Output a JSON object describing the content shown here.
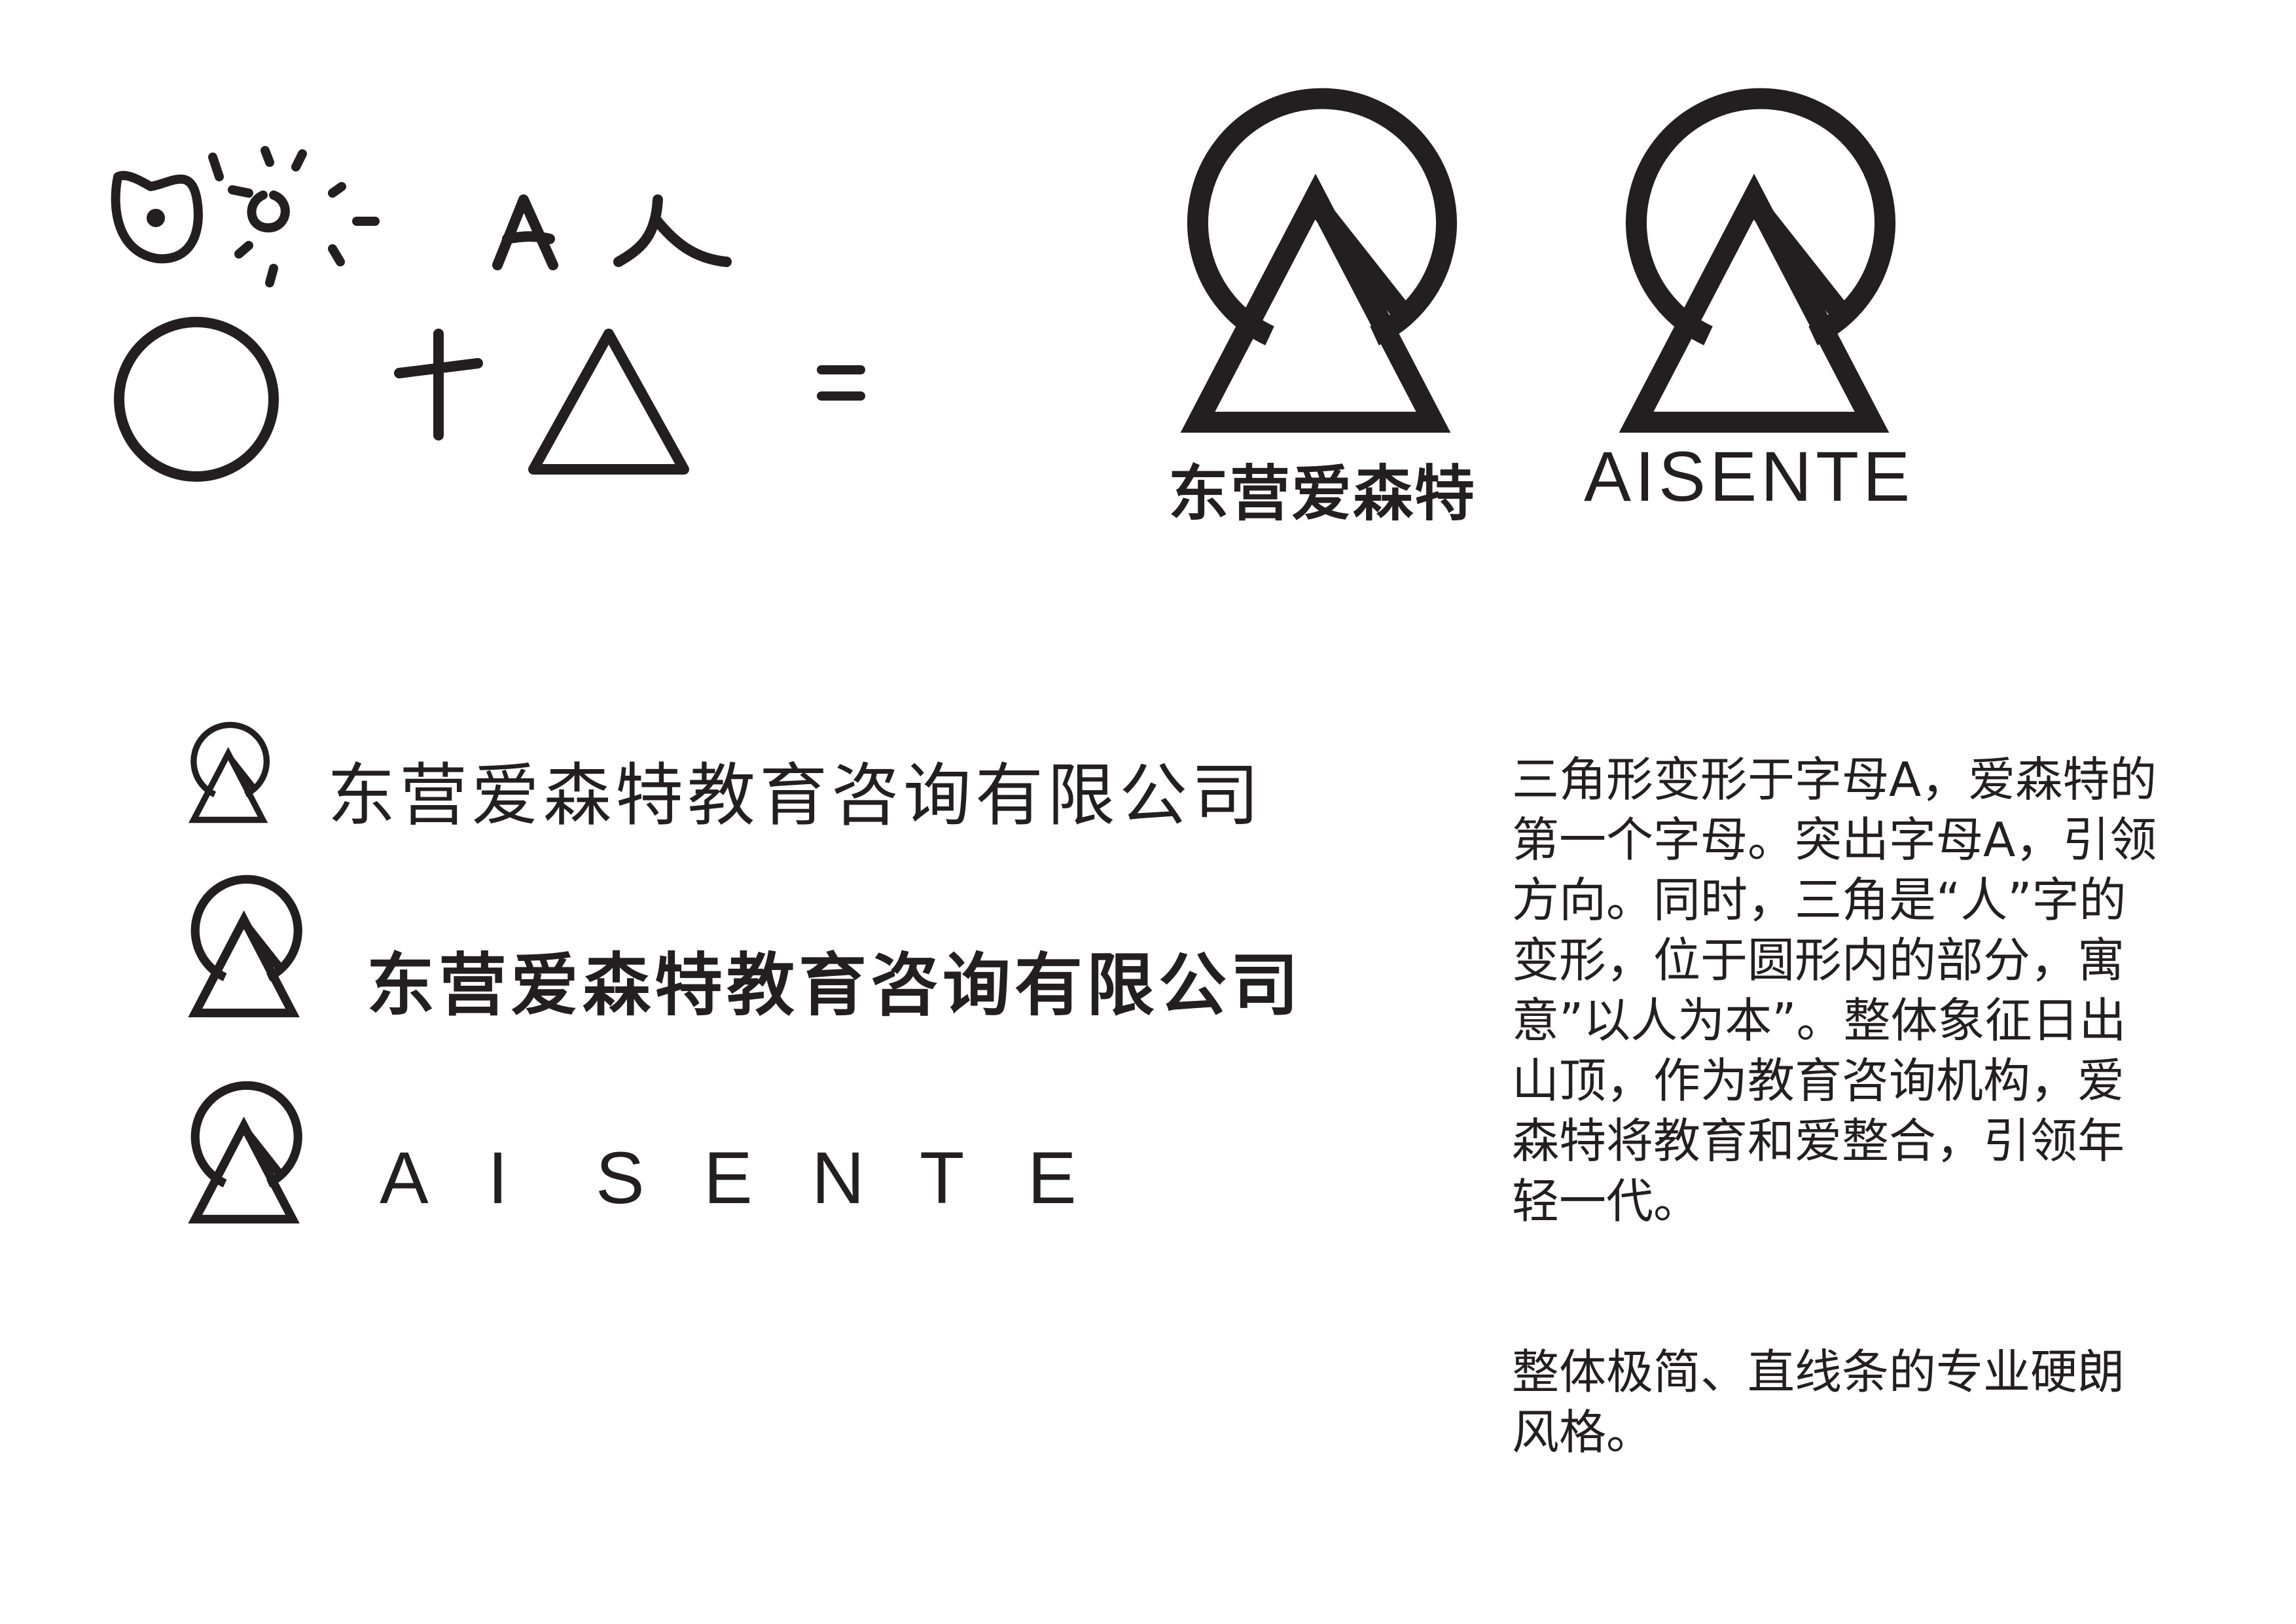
{
  "colors": {
    "ink": "#231f20",
    "background": "#ffffff"
  },
  "logos": {
    "chinese_name": "东营爱森特",
    "english_name": "AISENTE"
  },
  "lockups": {
    "light_full_name": "东营爱森特教育咨询有限公司",
    "bold_full_name": "东营爱森特教育咨询有限公司",
    "spaced_letters": [
      "A",
      "I",
      "S",
      "E",
      "N",
      "T",
      "E"
    ]
  },
  "description": {
    "paragraph1": "三角形变形于字母A，爱森特的第一个字母。突出字母A，引领方向。同时，三角是“人”字的变形，位于圆形内的部分，寓意”以人为本”。整体象征日出山顶，作为教育咨询机构，爱森特将教育和爱整合，引领年轻一代。",
    "paragraph2": "整体极简、直线条的专业硬朗风格。"
  },
  "icons": [
    "sun-face-doodle",
    "sun-rays-doodle",
    "letter-a-doodle",
    "person-glyph-doodle",
    "circle-shape",
    "plus-sign",
    "triangle-shape",
    "equals-sign",
    "aisente-logo-mark"
  ]
}
